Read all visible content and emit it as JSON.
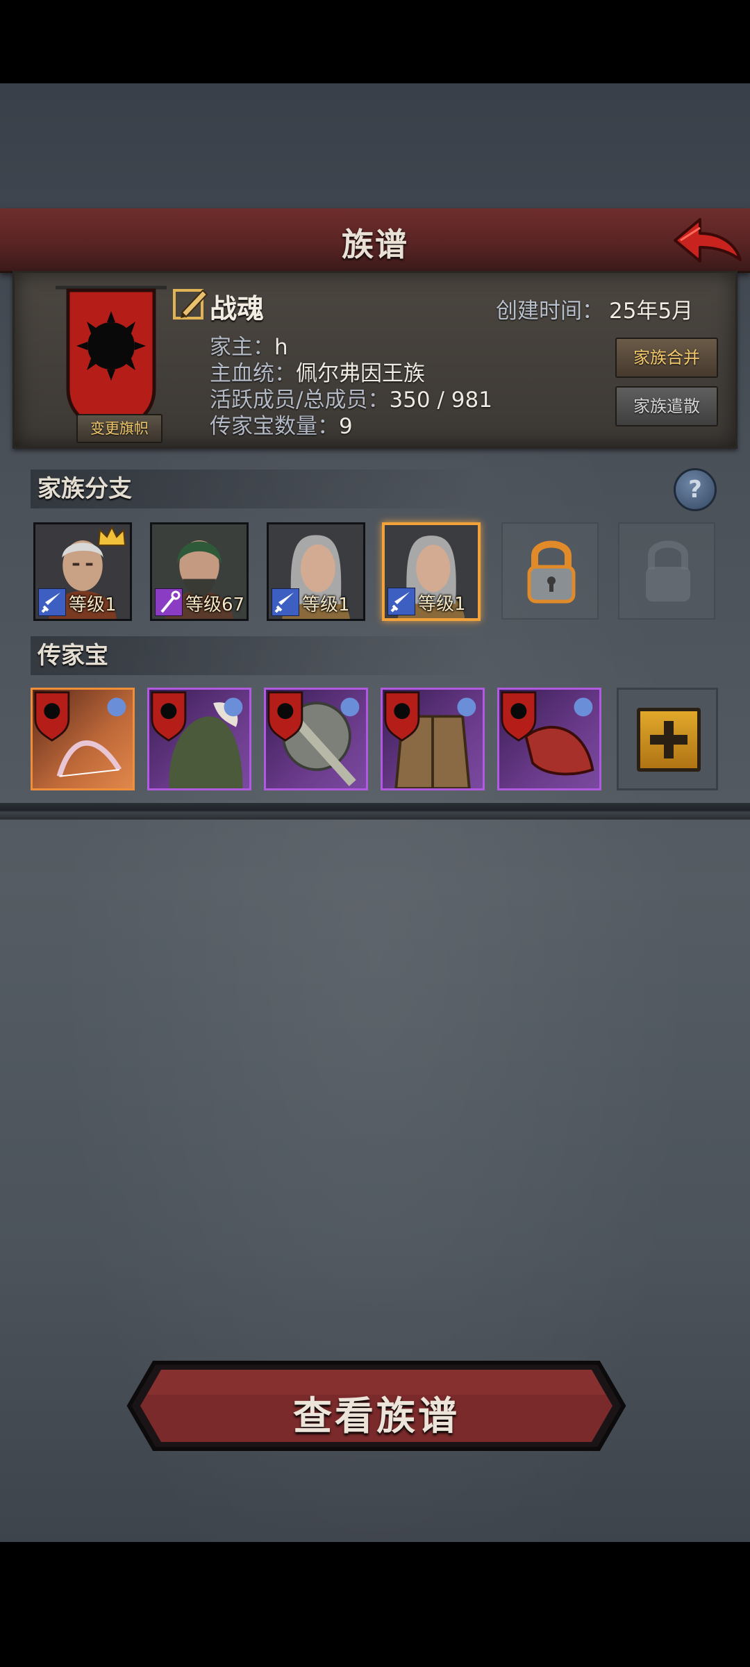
{
  "header": {
    "title": "族谱"
  },
  "family": {
    "name": "战魂",
    "created_label": "创建时间：",
    "created_value": "25年5月",
    "owner_label": "家主：",
    "owner_value": "h",
    "bloodline_label": "主血统：",
    "bloodline_value": "佩尔弗因王族",
    "members_label": "活跃成员/总成员：",
    "members_value": "350 / 981",
    "heirloom_count_label": "传家宝数量：",
    "heirloom_count_value": "9",
    "change_banner_label": "变更旗帜",
    "merge_label": "家族合并",
    "disband_label": "家族遣散"
  },
  "branches": {
    "title": "家族分支",
    "help_label": "?",
    "items": [
      {
        "level": "等级1",
        "class_icon": "sword-icon",
        "leader": true,
        "selected": false
      },
      {
        "level": "等级67",
        "class_icon": "staff-icon",
        "leader": false,
        "selected": false
      },
      {
        "level": "等级1",
        "class_icon": "sword-icon",
        "leader": false,
        "selected": false
      },
      {
        "level": "等级1",
        "class_icon": "sword-icon",
        "leader": false,
        "selected": true
      }
    ],
    "locked_slots": 2
  },
  "heirlooms": {
    "title": "传家宝",
    "items": [
      {
        "item": "bow-icon",
        "rarity": "orange"
      },
      {
        "item": "cloak-icon",
        "rarity": "purple"
      },
      {
        "item": "axe-icon",
        "rarity": "purple"
      },
      {
        "item": "armor-icon",
        "rarity": "purple"
      },
      {
        "item": "gauntlet-icon",
        "rarity": "purple"
      }
    ],
    "add_icon": "plus-icon"
  },
  "actions": {
    "view_tree_label": "查看族谱"
  },
  "colors": {
    "accent_red": "#6e2e2c",
    "gold": "#f4c86c",
    "purple_rarity": "#b05ae0",
    "orange_rarity": "#f08f3a"
  }
}
